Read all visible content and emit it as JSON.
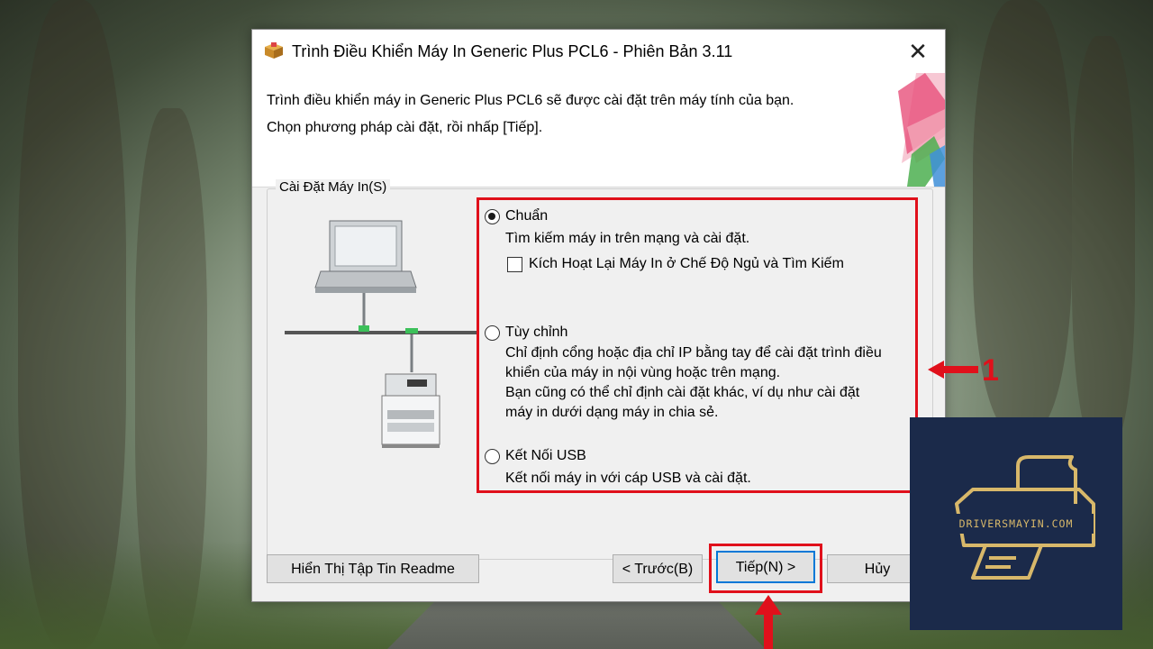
{
  "dialog": {
    "title": "Trình Điều Khiển Máy In Generic Plus PCL6 - Phiên Bản 3.11",
    "close_label": "✕",
    "header_line1": "Trình điều khiển máy in Generic Plus PCL6 sẽ được cài đặt trên máy tính của bạn.",
    "header_line2": "Chọn phương pháp cài đặt, rồi nhấp [Tiếp]."
  },
  "group": {
    "label": "Cài Đặt Máy In(S)"
  },
  "options": {
    "standard": {
      "label": "Chuẩn",
      "selected": true,
      "desc": "Tìm kiếm máy in trên mạng và cài đặt.",
      "checkbox_label": "Kích Hoạt Lại Máy In ở Chế Độ Ngủ và Tìm Kiếm",
      "checkbox_checked": false
    },
    "custom": {
      "label": "Tùy chỉnh",
      "selected": false,
      "desc1": "Chỉ định cổng hoặc địa chỉ IP bằng tay để cài đặt trình điều",
      "desc2": "khiển của máy in nội vùng hoặc trên mạng.",
      "desc3": "Bạn cũng có thể chỉ định cài đặt khác, ví dụ như cài đặt",
      "desc4": "máy in dưới dạng máy in chia sẻ."
    },
    "usb": {
      "label": "Kết Nối USB",
      "selected": false,
      "desc": "Kết nối máy in với cáp USB và cài đặt."
    }
  },
  "buttons": {
    "readme": "Hiển Thị Tập Tin Readme",
    "back": "< Trước(B)",
    "next": "Tiếp(N) >",
    "cancel": "Hủy"
  },
  "annotations": {
    "number": "1",
    "color": "#e0101b"
  },
  "logo": {
    "text": "DRIVERSMAYIN.COM",
    "bg_color": "#1b2a4a",
    "accent_color": "#d8b86a"
  }
}
